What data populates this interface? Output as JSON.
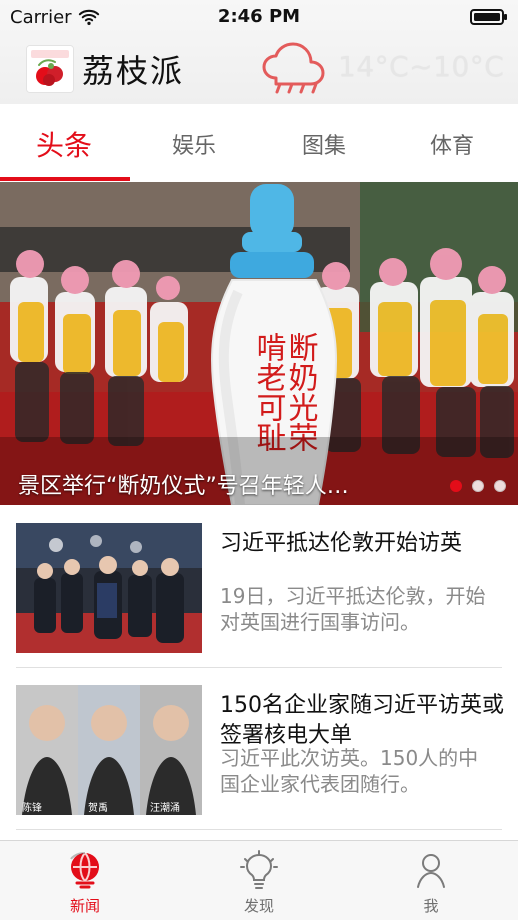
{
  "status_bar": {
    "carrier": "Carrier",
    "time": "2:46 PM",
    "wifi_icon": "wifi-icon",
    "battery_icon": "battery-icon"
  },
  "header": {
    "logo_icon": "lychee-logo",
    "title": "荔枝派",
    "weather_icon": "rain-cloud-icon",
    "temperature": "14°C~10°C"
  },
  "tabs": [
    {
      "label": "头条",
      "active": true
    },
    {
      "label": "娱乐",
      "active": false
    },
    {
      "label": "图集",
      "active": false
    },
    {
      "label": "体育",
      "active": false
    }
  ],
  "hero": {
    "caption": "景区举行“断奶仪式”号召年轻人…",
    "image_text": [
      "断奶光荣",
      "啃老可耻"
    ],
    "active_dot": 0,
    "dot_count": 3
  },
  "news": [
    {
      "title": "习近平抵达伦敦开始访英",
      "summary": "19日，习近平抵达伦敦，开始对英国进行国事访问。"
    },
    {
      "title": "150名企业家随习近平访英或签署核电大单",
      "summary": "习近平此次访英。150人的中国企业家代表团随行。",
      "thumbnail_labels": [
        "陈锋",
        "贺禹",
        "汪潮涌"
      ]
    }
  ],
  "bottom_bar": [
    {
      "label": "新闻",
      "icon": "globe-icon",
      "active": true
    },
    {
      "label": "发现",
      "icon": "lightbulb-icon",
      "active": false
    },
    {
      "label": "我",
      "icon": "person-icon",
      "active": false
    }
  ],
  "colors": {
    "accent": "#e30d19",
    "header_bg": "#f2f2f2",
    "muted_text": "#8a8a8a"
  }
}
